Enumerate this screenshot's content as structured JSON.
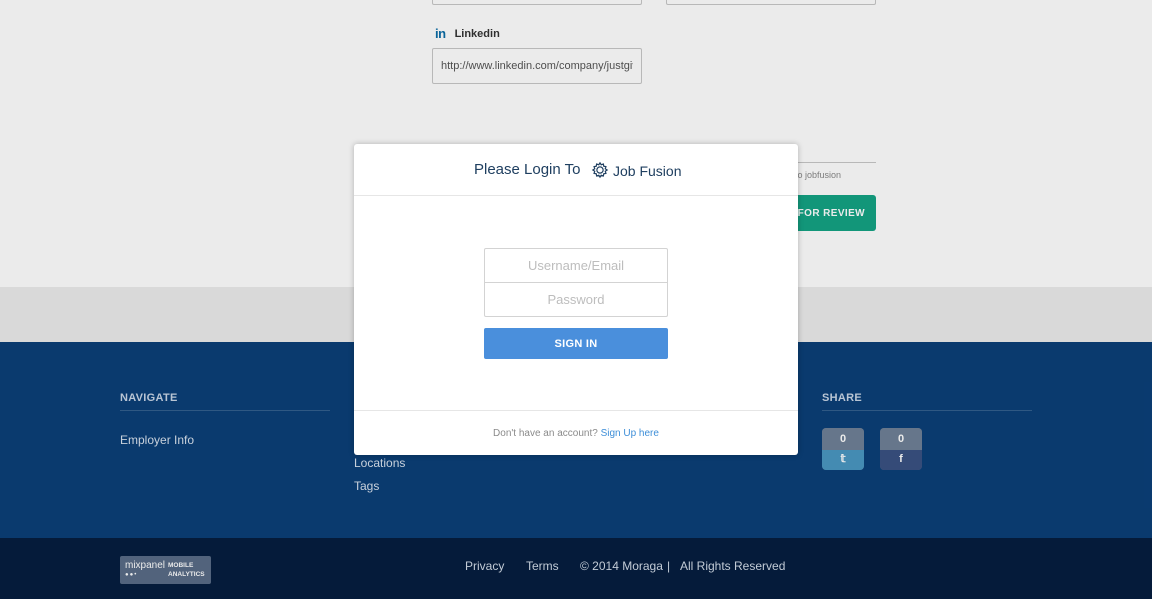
{
  "background_form": {
    "linkedin_label": "Linkedin",
    "linkedin_icon": "linkedin-icon",
    "linkedin_value": "http://www.linkedin.com/company/justgiv",
    "agree_text": "/ to jobfusion",
    "submit_label": "T FOR REVIEW"
  },
  "footer": {
    "navigate": {
      "heading": "NAVIGATE",
      "links": [
        "Employer Info"
      ]
    },
    "middle": {
      "links": [
        "Locations",
        "Tags"
      ]
    },
    "share": {
      "heading": "SHARE",
      "twitter": {
        "count": "0",
        "icon": "twitter-icon",
        "glyph": "𝕥"
      },
      "facebook": {
        "count": "0",
        "icon": "facebook-icon",
        "glyph": "f"
      }
    }
  },
  "bottom_bar": {
    "mixpanel": {
      "name": "mixpanel",
      "dots": "●●•",
      "t1": "MOBILE",
      "t2": "ANALYTICS"
    },
    "privacy": "Privacy",
    "terms": "Terms",
    "copyright": "© 2014 Moraga",
    "separator": "|",
    "rights": "All Rights Reserved"
  },
  "modal": {
    "title": "Please Login To",
    "brand_icon": "gear-logo-icon",
    "brand_name": "Job Fusion",
    "username_placeholder": "Username/Email",
    "password_placeholder": "Password",
    "signin_label": "SIGN IN",
    "signup_prompt": "Don't have an account?",
    "signup_link": "Sign Up here",
    "accent_color": "#4a8fdc"
  }
}
